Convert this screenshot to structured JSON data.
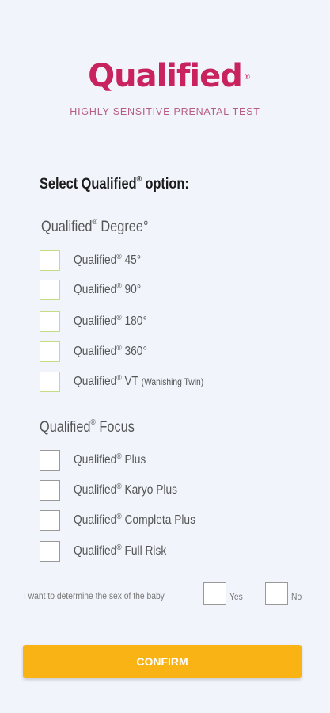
{
  "brand": {
    "logo_text": "Qualified",
    "reg_mark": "®",
    "tagline": "HIGHLY SENSITIVE PRENATAL TEST"
  },
  "heading": {
    "prefix": "Select Qualified",
    "reg": "®",
    "suffix": " option:"
  },
  "degree": {
    "title_prefix": "Qualified",
    "reg": "®",
    "title_suffix": " Degree°",
    "options": [
      {
        "prefix": "Qualified",
        "reg": "®",
        "suffix": " 45°",
        "checked": false
      },
      {
        "prefix": "Qualified",
        "reg": "®",
        "suffix": " 90°",
        "checked": false
      },
      {
        "prefix": "Qualified",
        "reg": "®",
        "suffix": " 180°",
        "checked": false
      },
      {
        "prefix": "Qualified",
        "reg": "®",
        "suffix": " 360°",
        "checked": false
      },
      {
        "prefix": "Qualified",
        "reg": "®",
        "suffix": " VT ",
        "note": "(Wanishing Twin)",
        "checked": false
      }
    ]
  },
  "focus": {
    "title_prefix": "Qualified",
    "reg": "®",
    "title_suffix": " Focus",
    "options": [
      {
        "prefix": "Qualified",
        "reg": "®",
        "suffix": " Plus",
        "checked": false
      },
      {
        "prefix": "Qualified",
        "reg": "®",
        "suffix": " Karyo Plus",
        "checked": false
      },
      {
        "prefix": "Qualified",
        "reg": "®",
        "suffix": " Completa Plus",
        "checked": false
      },
      {
        "prefix": "Qualified",
        "reg": "®",
        "suffix": " Full Risk",
        "checked": false
      }
    ]
  },
  "sex": {
    "label": "I want to determine the sex of the baby",
    "yes_label": "Yes",
    "no_label": "No",
    "yes_checked": false,
    "no_checked": false
  },
  "confirm_label": "CONFIRM",
  "colors": {
    "brand": "#c8235f",
    "tagline": "#b75c85",
    "confirm": "#f9b315",
    "degree_checkbox_border": "#c5dc86",
    "focus_checkbox_border": "#999999",
    "background": "#f1f5fb"
  }
}
